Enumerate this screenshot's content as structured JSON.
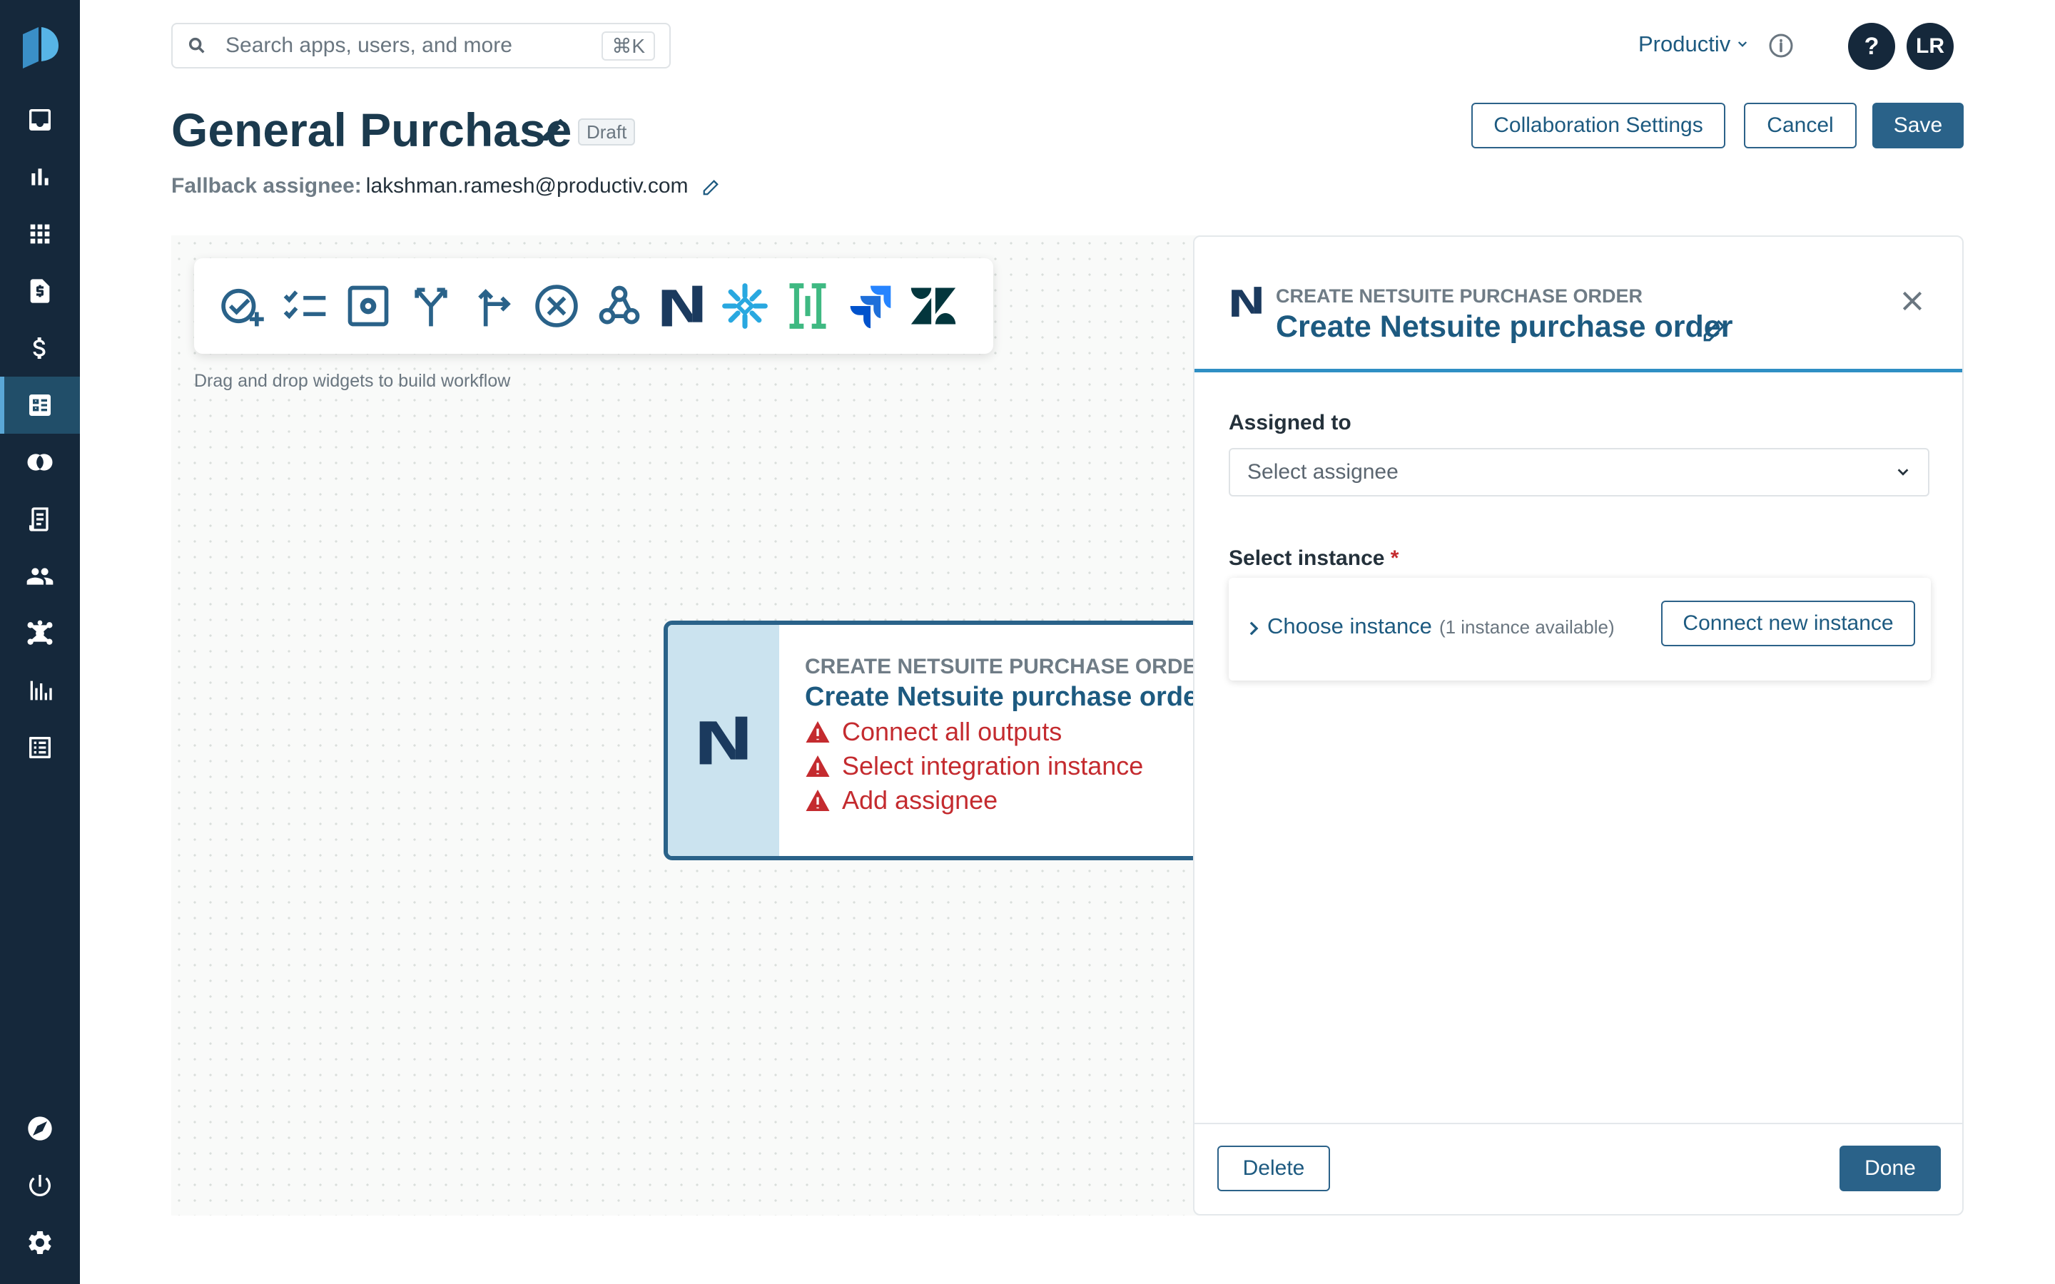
{
  "search": {
    "placeholder": "Search apps, users, and more",
    "shortcut": "⌘K"
  },
  "header": {
    "org_name": "Productiv",
    "help_label": "?",
    "avatar_initials": "LR"
  },
  "workflow": {
    "title": "General Purchase",
    "status_badge": "Draft",
    "fallback_label": "Fallback assignee:",
    "fallback_value": "lakshman.ramesh@productiv.com"
  },
  "actions": {
    "collaboration": "Collaboration Settings",
    "cancel": "Cancel",
    "save": "Save"
  },
  "canvas": {
    "hint": "Drag and drop widgets to build workflow",
    "toolbar_icons": [
      "approval-add-icon",
      "checklist-icon",
      "settings-box-icon",
      "split-branch-icon",
      "branch-icon",
      "cancel-circle-icon",
      "webhook-icon",
      "netsuite-icon",
      "snowflake-icon",
      "coupa-icon",
      "jira-icon",
      "zendesk-icon"
    ],
    "node": {
      "kicker": "CREATE NETSUITE PURCHASE ORDER",
      "title": "Create Netsuite purchase order",
      "warnings": [
        "Connect all outputs",
        "Select integration instance",
        "Add assignee"
      ]
    }
  },
  "panel": {
    "kicker": "CREATE NETSUITE PURCHASE ORDER",
    "title": "Create Netsuite purchase order",
    "assigned_label": "Assigned to",
    "assignee_placeholder": "Select assignee",
    "instance_label": "Select instance",
    "required_mark": "*",
    "choose_instance": "Choose instance",
    "instance_available": "(1 instance available)",
    "connect_new": "Connect new instance",
    "delete": "Delete",
    "done": "Done"
  },
  "colors": {
    "sidebar_bg": "#15283b",
    "primary": "#2a6289",
    "accent_line": "#2f8fc4",
    "error": "#c42b2f"
  }
}
